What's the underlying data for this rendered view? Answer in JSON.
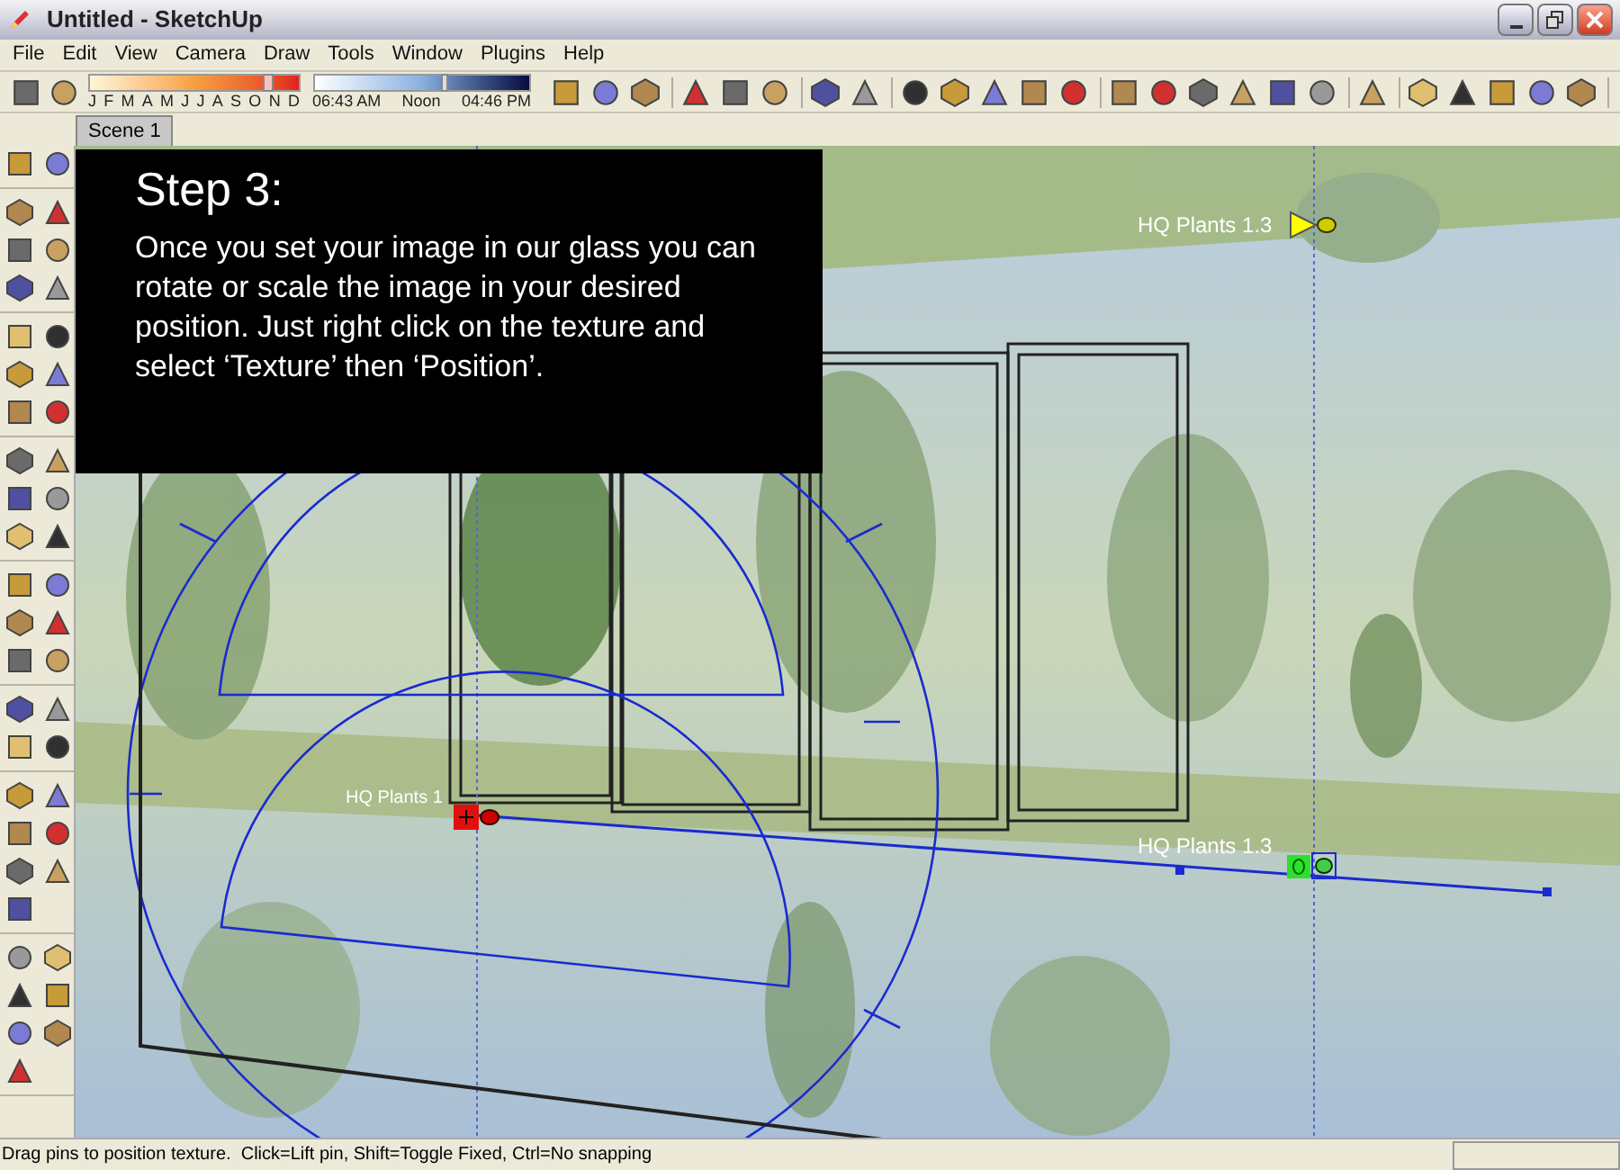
{
  "window": {
    "title": "Untitled - SketchUp"
  },
  "menu": [
    "File",
    "Edit",
    "View",
    "Camera",
    "Draw",
    "Tools",
    "Window",
    "Plugins",
    "Help"
  ],
  "shadow_toolbar": {
    "months": [
      "J",
      "F",
      "M",
      "A",
      "M",
      "J",
      "J",
      "A",
      "S",
      "O",
      "N",
      "D"
    ],
    "date_slider": {
      "level": 0.86
    },
    "time_slider": {
      "level": 0.6
    },
    "times": [
      "06:43 AM",
      "Noon",
      "04:46 PM"
    ]
  },
  "scene_tabs": [
    {
      "label": "Scene 1",
      "selected": true
    }
  ],
  "overlay": {
    "heading": "Step 3:",
    "body": "Once you set your image in our glass you can rotate or scale the image in your desired position. Just right click on the texture and select ‘Texture’  then ‘Position’."
  },
  "pin_labels": [
    "HQ Plants 1.3",
    "HQ Plants 1",
    "HQ Plants 1.3"
  ],
  "status_bar": {
    "text": "Drag pins to position texture.  Click=Lift pin, Shift=Toggle Fixed, Ctrl=No snapping"
  }
}
